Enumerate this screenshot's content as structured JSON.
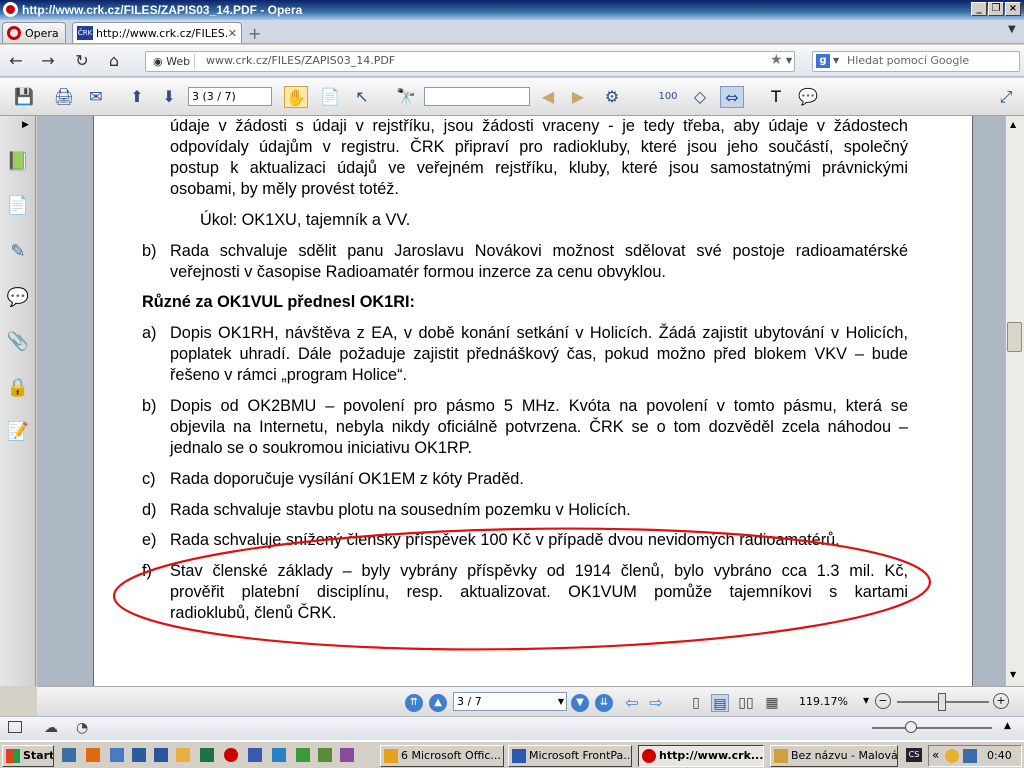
{
  "window": {
    "title": "http://www.crk.cz/FILES/ZAPIS03_14.PDF - Opera"
  },
  "tabs": [
    {
      "label": "Opera"
    },
    {
      "label": "http://www.crk.cz/FILES..."
    }
  ],
  "addressbar": {
    "web_label": "Web",
    "url": "www.crk.cz/FILES/ZAPIS03_14.PDF",
    "search_placeholder": "Hledat pomocí Google"
  },
  "pdf_toolbar": {
    "page_field": "3 (3 / 7)",
    "find_value": ""
  },
  "document": {
    "para_top_1": "údaje v žádosti s údaji v rejstříku, jsou žádosti vraceny - je tedy třeba, aby údaje v žádostech",
    "para_top_2": "odpovídaly údajům v registru. ČRK připraví pro radiokluby, které jsou jeho součástí, společný",
    "para_top_3": "postup k aktualizaci údajů ve veřejném rejstříku, kluby, které jsou samostatnými právnickými",
    "para_top_4": "osobami, by měly provést totéž.",
    "task": "Úkol: OK1XU, tajemník a VV.",
    "b1_label": "b)",
    "b1_1": "Rada schvaluje sdělit panu Jaroslavu Novákovi možnost sdělovat své postoje radioamatérské",
    "b1_2": "veřejnosti v časopise Radioamatér formou inzerce za cenu obvyklou.",
    "heading": "Různé za OK1VUL přednesl OK1RI:",
    "items": [
      {
        "label": "a)",
        "lines": [
          "Dopis OK1RH, návštěva z EA, v době konání setkání v Holicích. Žádá zajistit ubytování v Holicích,",
          "poplatek uhradí. Dále požaduje zajistit přednáškový čas, pokud možno před blokem VKV – bude",
          "řešeno v rámci „program Holice“."
        ]
      },
      {
        "label": "b)",
        "lines": [
          "Dopis od OK2BMU – povolení pro pásmo 5 MHz. Kvóta na povolení v tomto pásmu, která se",
          "objevila na Internetu, nebyla nikdy oficiálně potvrzena. ČRK se o tom dozvěděl zcela náhodou –",
          "jednalo se o soukromou iniciativu OK1RP."
        ]
      },
      {
        "label": "c)",
        "lines": [
          "Rada doporučuje vysílání OK1EM z kóty Praděd."
        ]
      },
      {
        "label": "d)",
        "lines": [
          "Rada schvaluje stavbu plotu na sousedním pozemku v Holicích."
        ]
      },
      {
        "label": "e)",
        "lines": [
          "Rada schvaluje snížený členský příspěvek 100 Kč v případě dvou nevidomých radioamatérů."
        ]
      },
      {
        "label": "f)",
        "lines": [
          "Stav členské základy – byly vybrány příspěvky od 1914 členů, bylo vybráno cca 1.3 mil. Kč,",
          "prověřit platební disciplínu, resp. aktualizovat. OK1VUM pomůže tajemníkovi s kartami",
          "radioklubů, členů ČRK."
        ]
      }
    ],
    "highlight_color": "#e01010"
  },
  "pdf_bottom": {
    "page_select": "3 / 7",
    "zoom": "119.17%"
  },
  "taskbar": {
    "start": "Start",
    "tasks": [
      "6 Microsoft Offic...",
      "Microsoft FrontPa...",
      "http://www.crk....",
      "Bez názvu - Malování"
    ],
    "tray_more": "«",
    "clock": "0:40"
  }
}
